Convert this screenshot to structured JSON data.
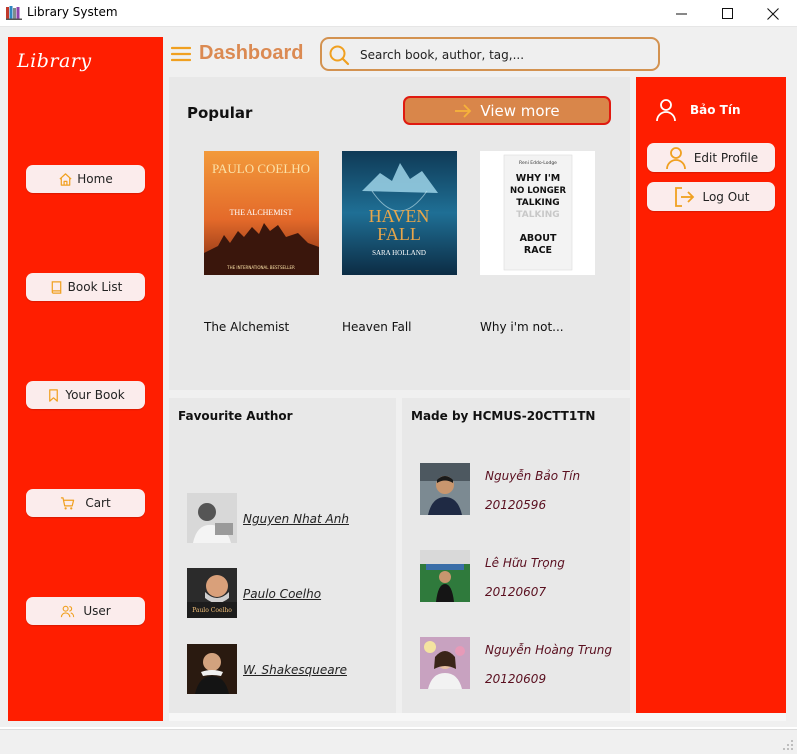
{
  "window": {
    "title": "Library System",
    "minimize": "—",
    "maximize": "☐",
    "close": "✕"
  },
  "sidebar": {
    "logo": "Library",
    "nav": [
      {
        "label": "Home",
        "icon": "home-icon"
      },
      {
        "label": "Book List",
        "icon": "book-icon"
      },
      {
        "label": "Your Book",
        "icon": "bookmark-icon"
      },
      {
        "label": "Cart",
        "icon": "cart-icon"
      },
      {
        "label": "User",
        "icon": "users-icon"
      }
    ]
  },
  "header": {
    "title": "Dashboard",
    "search_placeholder": "Search book, author, tag,..."
  },
  "popular": {
    "heading": "Popular",
    "view_more": "View more",
    "books": [
      {
        "title": "The Alchemist",
        "cover_author": "PAULO COELHO",
        "cover_title": "THE ALCHEMIST",
        "cover_note": "THE INTERNATIONAL BESTSELLER"
      },
      {
        "title": "Heaven Fall",
        "cover_title_1": "HAVEN",
        "cover_title_2": "FALL",
        "cover_author": "SARA HOLLAND"
      },
      {
        "title": "Why i'm not...",
        "cover_author": "Reni Eddo-Lodge",
        "cover_line1": "WHY I'M",
        "cover_line2": "NO LONGER",
        "cover_line3": "TALKING",
        "cover_line4": "ABOUT",
        "cover_line5": "RACE"
      }
    ]
  },
  "favourite_author": {
    "heading": "Favourite Author",
    "authors": [
      {
        "name": "Nguyen Nhat Anh"
      },
      {
        "name": "Paulo Coelho"
      },
      {
        "name": "W. Shakesqueare"
      }
    ]
  },
  "made_by": {
    "heading": "Made by HCMUS-20CTT1TN",
    "members": [
      {
        "name": "Nguyễn Bảo Tín",
        "id": "20120596"
      },
      {
        "name": "Lê Hữu Trọng",
        "id": "20120607"
      },
      {
        "name": "Nguyễn Hoàng Trung",
        "id": "20120609"
      }
    ]
  },
  "user_panel": {
    "username": "Bảo Tín",
    "edit_profile": "Edit Profile",
    "log_out": "Log Out"
  },
  "colors": {
    "sidebar_red": "#ff1e00",
    "accent_orange": "#db8a52",
    "icon_orange": "#f0a020",
    "panel_gray": "#e8e8e8"
  }
}
